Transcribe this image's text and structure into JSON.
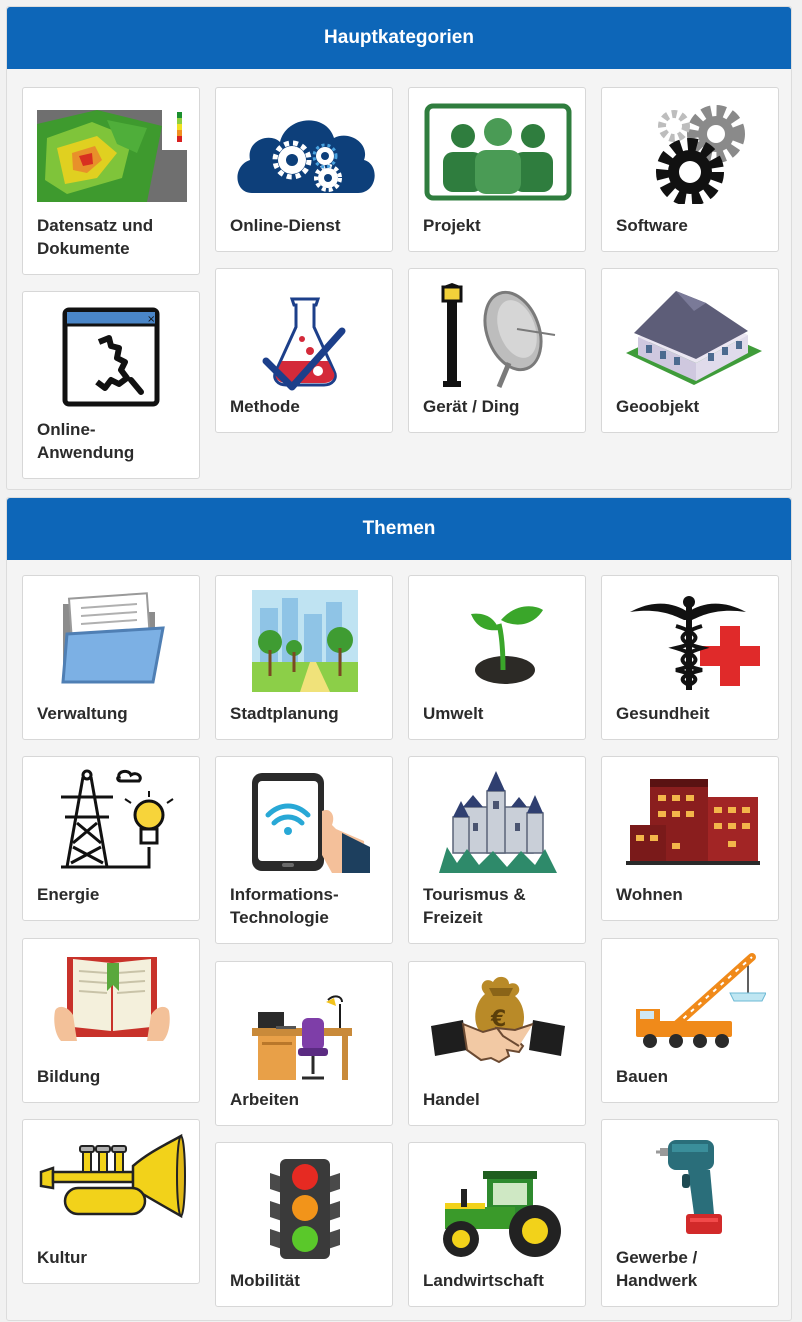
{
  "main_categories": {
    "title": "Hauptkategorien",
    "items": [
      {
        "label": "Datensatz und Dokumente",
        "icon": "dataset-map-icon"
      },
      {
        "label": "Online-Dienst",
        "icon": "cloud-gears-icon"
      },
      {
        "label": "Projekt",
        "icon": "team-icon"
      },
      {
        "label": "Software",
        "icon": "gears-icon"
      },
      {
        "label": "Online-Anwendung",
        "icon": "app-window-icon"
      },
      {
        "label": "Methode",
        "icon": "flask-icon"
      },
      {
        "label": "Gerät / Ding",
        "icon": "lamp-satellite-icon"
      },
      {
        "label": "Geoobjekt",
        "icon": "building-icon"
      }
    ]
  },
  "themes": {
    "title": "Themen",
    "items": [
      {
        "label": "Verwaltung",
        "icon": "folder-icon"
      },
      {
        "label": "Stadtplanung",
        "icon": "city-park-icon"
      },
      {
        "label": "Umwelt",
        "icon": "sprout-icon"
      },
      {
        "label": "Gesundheit",
        "icon": "caduceus-cross-icon"
      },
      {
        "label": "Energie",
        "icon": "power-tower-bulb-icon"
      },
      {
        "label": "Informations-Technologie",
        "icon": "tablet-wifi-icon"
      },
      {
        "label": "Tourismus & Freizeit",
        "icon": "castle-icon"
      },
      {
        "label": "Wohnen",
        "icon": "apartment-buildings-icon"
      },
      {
        "label": "Bildung",
        "icon": "open-book-icon"
      },
      {
        "label": "Arbeiten",
        "icon": "desk-icon"
      },
      {
        "label": "Handel",
        "icon": "handshake-money-icon"
      },
      {
        "label": "Bauen",
        "icon": "crane-icon"
      },
      {
        "label": "Kultur",
        "icon": "trumpet-icon"
      },
      {
        "label": "Mobilität",
        "icon": "traffic-light-icon"
      },
      {
        "label": "Landwirtschaft",
        "icon": "tractor-icon"
      },
      {
        "label": "Gewerbe / Handwerk",
        "icon": "drill-icon"
      }
    ]
  },
  "colors": {
    "header": "#0d66b8",
    "tile_bg": "#ffffff"
  }
}
